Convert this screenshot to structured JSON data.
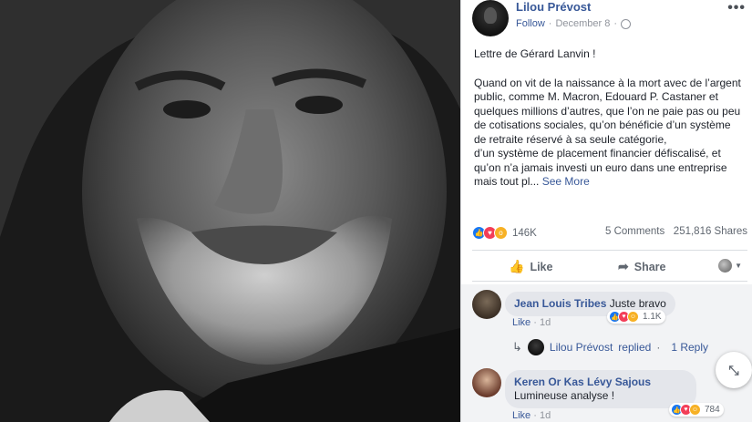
{
  "post": {
    "author": "Lilou Prévost",
    "follow": "Follow",
    "separator": "·",
    "date": "December 8",
    "more_icon": "ellipsis-icon",
    "paragraphs": [
      "Lettre de Gérard Lanvin !",
      "Quand on vit de la naissance à la mort avec de l’argent public, comme M. Macron, Edouard P. Castaner et quelques millions d’autres, que l’on ne paie pas ou peu de cotisations sociales, qu’on bénéficie d’un système de retraite réservé à sa seule catégorie,\nd’un système de placement financier défiscalisé, et qu’on n’a jamais investi un euro dans une entreprise mais tout pl..."
    ],
    "see_more": "See More"
  },
  "stats": {
    "reaction_count": "146K",
    "comments": "5 Comments",
    "shares": "251,816 Shares"
  },
  "actions": {
    "like": "Like",
    "share": "Share"
  },
  "comments": [
    {
      "name": "Jean Louis Tribes",
      "text": "Juste bravo",
      "like": "Like",
      "dot": "·",
      "time": "1d",
      "reaction_count": "1.1K",
      "reply": {
        "name": "Lilou Prévost",
        "replied": "replied",
        "dot": "·",
        "count": "1 Reply"
      }
    },
    {
      "name": "Keren Or Kas Lévy Sajous",
      "text": "Lumineuse analyse !",
      "like": "Like",
      "dot": "·",
      "time": "1d",
      "reaction_count": "784"
    }
  ],
  "colors": {
    "link": "#385898",
    "like_blue": "#1877f2",
    "love_red": "#f33e58",
    "wow_yellow": "#f7b125"
  }
}
